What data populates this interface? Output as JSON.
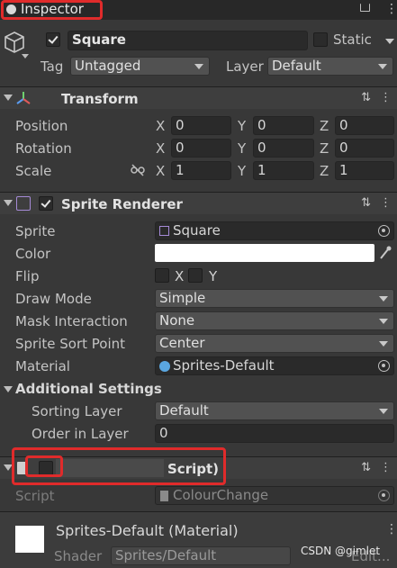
{
  "window": {
    "title": "Inspector"
  },
  "object": {
    "name": "Square",
    "static_label": "Static",
    "tag_label": "Tag",
    "tag_value": "Untagged",
    "layer_label": "Layer",
    "layer_value": "Default"
  },
  "transform": {
    "title": "Transform",
    "position_label": "Position",
    "rotation_label": "Rotation",
    "scale_label": "Scale",
    "axis_x": "X",
    "axis_y": "Y",
    "axis_z": "Z",
    "position": {
      "x": "0",
      "y": "0",
      "z": "0"
    },
    "rotation": {
      "x": "0",
      "y": "0",
      "z": "0"
    },
    "scale": {
      "x": "1",
      "y": "1",
      "z": "1"
    }
  },
  "sprite_renderer": {
    "title": "Sprite Renderer",
    "sprite_label": "Sprite",
    "sprite_value": "Square",
    "color_label": "Color",
    "color_value": "#ffffff",
    "flip_label": "Flip",
    "flip_x": "X",
    "flip_y": "Y",
    "draw_mode_label": "Draw Mode",
    "draw_mode_value": "Simple",
    "mask_label": "Mask Interaction",
    "mask_value": "None",
    "sort_point_label": "Sprite Sort Point",
    "sort_point_value": "Center",
    "material_label": "Material",
    "material_value": "Sprites-Default",
    "additional_settings": "Additional Settings",
    "sorting_layer_label": "Sorting Layer",
    "sorting_layer_value": "Default",
    "order_label": "Order in Layer",
    "order_value": "0"
  },
  "script_component": {
    "title": "Script)",
    "script_label": "Script",
    "script_value": "ColourChange"
  },
  "material": {
    "title": "Sprites-Default (Material)",
    "shader_label": "Shader",
    "shader_value": "Sprites/Default",
    "edit_label": "Edit..."
  },
  "watermark": "CSDN @gimlet",
  "colors": {
    "highlight": "#e02b2b",
    "panel": "#383838"
  }
}
